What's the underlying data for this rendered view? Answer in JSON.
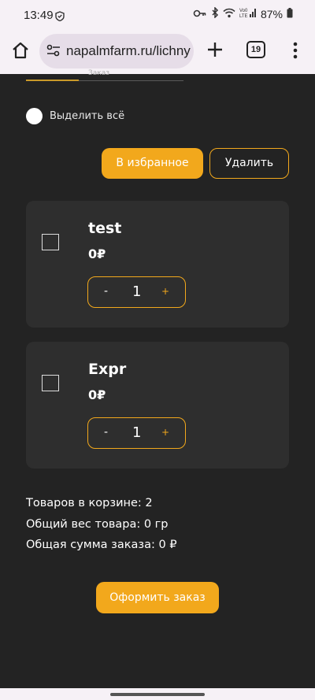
{
  "status_bar": {
    "time": "13:49",
    "battery": "87%"
  },
  "browser": {
    "url": "napalmfarm.ru/lichny",
    "tab_count": "19"
  },
  "page": {
    "tab_cut_text": "Заказ",
    "select_all_label": "Выделить всё",
    "favorites_button": "В избранное",
    "delete_button": "Удалить",
    "items": [
      {
        "name": "test",
        "price": "0₽",
        "quantity": "1",
        "minus": "-",
        "plus": "+"
      },
      {
        "name": "Expr",
        "price": "0₽",
        "quantity": "1",
        "minus": "-",
        "plus": "+"
      }
    ],
    "summary": {
      "items_count": "Товаров в корзине: 2",
      "total_weight": "Общий вес товара: 0 гр",
      "total_sum": "Общая сумма заказа: 0 ₽"
    },
    "checkout_button": "Оформить заказ"
  },
  "colors": {
    "accent": "#f2a81c",
    "background": "#232323",
    "card": "#2e2e2e"
  }
}
